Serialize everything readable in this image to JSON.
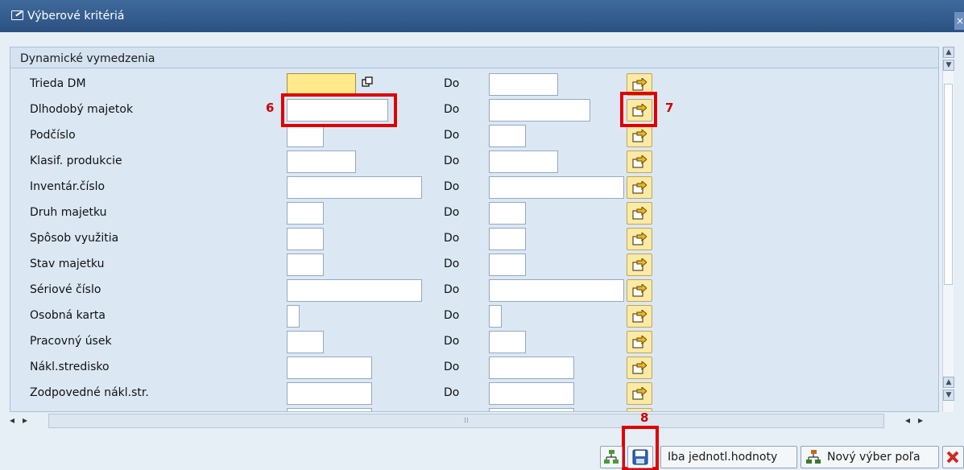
{
  "window": {
    "title": "Výberové kritériá",
    "close_symbol": "×"
  },
  "panel": {
    "header": "Dynamické vymedzenia",
    "do_label": "Do",
    "rows": [
      {
        "label": "Trieda DM",
        "from_value": "",
        "to_value": ""
      },
      {
        "label": "Dlhodobý majetok",
        "from_value": "",
        "to_value": ""
      },
      {
        "label": "Podčíslo",
        "from_value": "",
        "to_value": ""
      },
      {
        "label": "Klasif. produkcie",
        "from_value": "",
        "to_value": ""
      },
      {
        "label": "Inventár.číslo",
        "from_value": "",
        "to_value": ""
      },
      {
        "label": "Druh majetku",
        "from_value": "",
        "to_value": ""
      },
      {
        "label": "Spôsob využitia",
        "from_value": "",
        "to_value": ""
      },
      {
        "label": "Stav majetku",
        "from_value": "",
        "to_value": ""
      },
      {
        "label": "Sériové číslo",
        "from_value": "",
        "to_value": ""
      },
      {
        "label": "Osobná karta",
        "from_value": "",
        "to_value": ""
      },
      {
        "label": "Pracovný úsek",
        "from_value": "",
        "to_value": ""
      },
      {
        "label": "Nákl.stredisko",
        "from_value": "",
        "to_value": ""
      },
      {
        "label": "Zodpovedné nákl.str.",
        "from_value": "",
        "to_value": ""
      }
    ]
  },
  "annotations": {
    "six": "6",
    "seven": "7",
    "eight": "8"
  },
  "toolbar": {
    "single_values_label": "Iba jednotl.hodnoty",
    "new_selection_label": "Nový výber poľa"
  },
  "colors": {
    "accent": "#2b5180",
    "highlight": "#e00000",
    "required_field": "#ffe98b"
  }
}
